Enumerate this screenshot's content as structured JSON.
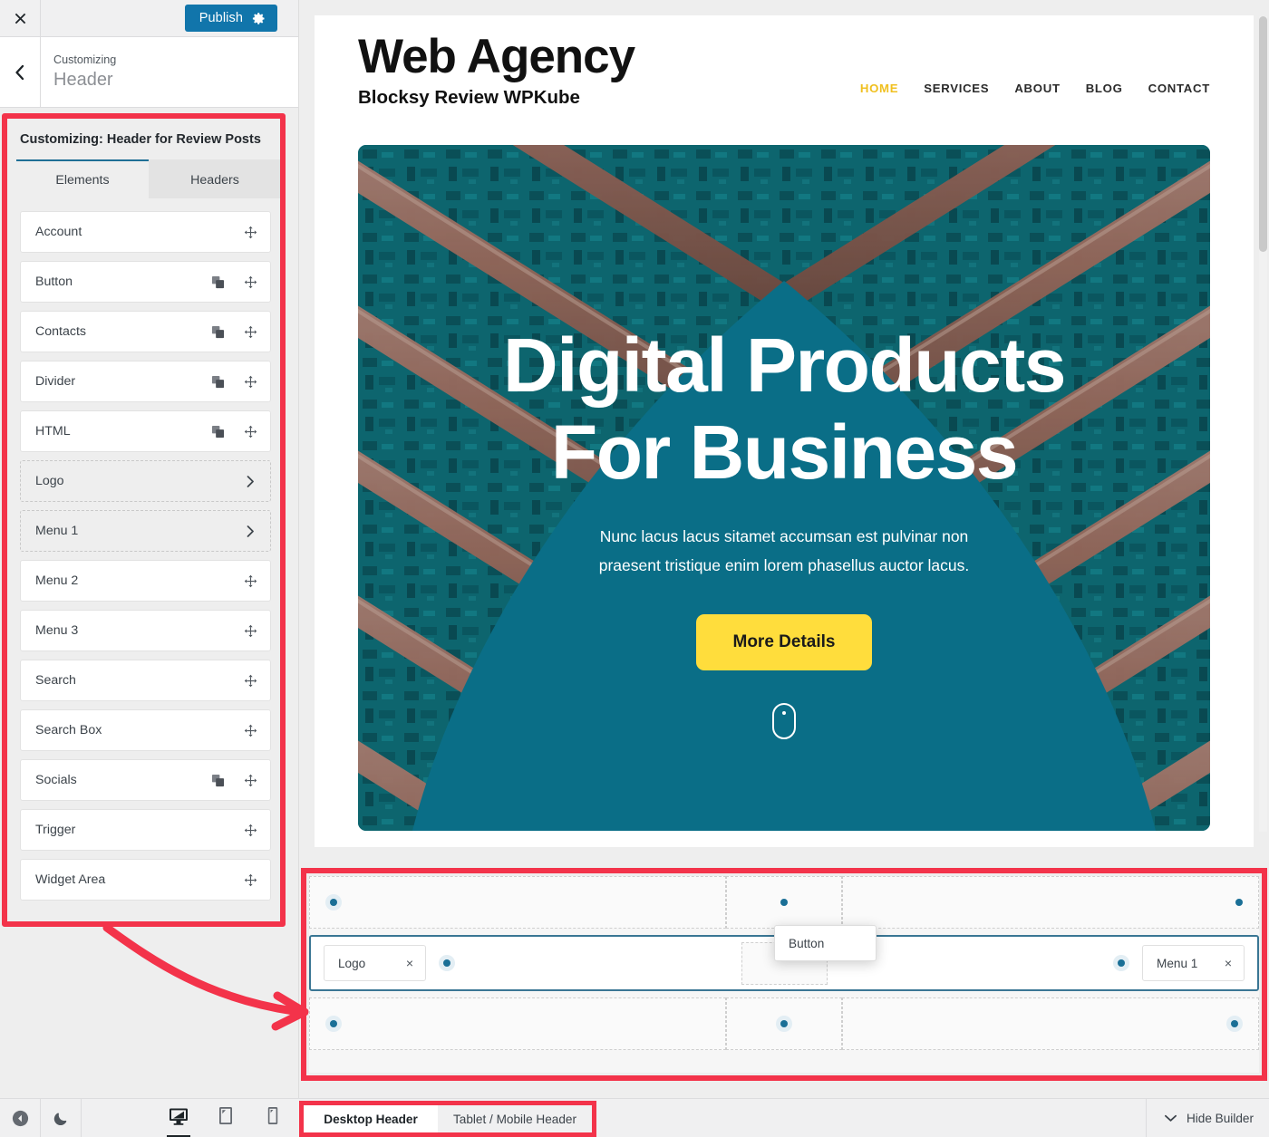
{
  "customizer": {
    "topbar": {
      "close_icon": "close-icon",
      "publish_label": "Publish",
      "gear_icon": "gear-icon"
    },
    "back_icon": "chevron-left-icon",
    "breadcrumb_label": "Customizing",
    "section_title": "Header",
    "panel_heading": "Customizing: Header for Review Posts",
    "tabs": [
      {
        "label": "Elements",
        "active": true
      },
      {
        "label": "Headers",
        "active": false
      }
    ],
    "elements": [
      {
        "label": "Account",
        "style": "solid",
        "has_copy": false,
        "has_move": true,
        "has_chevron": false
      },
      {
        "label": "Button",
        "style": "solid",
        "has_copy": true,
        "has_move": true,
        "has_chevron": false
      },
      {
        "label": "Contacts",
        "style": "solid",
        "has_copy": true,
        "has_move": true,
        "has_chevron": false
      },
      {
        "label": "Divider",
        "style": "solid",
        "has_copy": true,
        "has_move": true,
        "has_chevron": false
      },
      {
        "label": "HTML",
        "style": "solid",
        "has_copy": true,
        "has_move": true,
        "has_chevron": false
      },
      {
        "label": "Logo",
        "style": "dashed",
        "has_copy": false,
        "has_move": false,
        "has_chevron": true
      },
      {
        "label": "Menu 1",
        "style": "dashed",
        "has_copy": false,
        "has_move": false,
        "has_chevron": true
      },
      {
        "label": "Menu 2",
        "style": "solid",
        "has_copy": false,
        "has_move": true,
        "has_chevron": false
      },
      {
        "label": "Menu 3",
        "style": "solid",
        "has_copy": false,
        "has_move": true,
        "has_chevron": false
      },
      {
        "label": "Search",
        "style": "solid",
        "has_copy": false,
        "has_move": true,
        "has_chevron": false
      },
      {
        "label": "Search Box",
        "style": "solid",
        "has_copy": false,
        "has_move": true,
        "has_chevron": false
      },
      {
        "label": "Socials",
        "style": "solid",
        "has_copy": true,
        "has_move": true,
        "has_chevron": false
      },
      {
        "label": "Trigger",
        "style": "solid",
        "has_copy": false,
        "has_move": true,
        "has_chevron": false
      },
      {
        "label": "Widget Area",
        "style": "solid",
        "has_copy": false,
        "has_move": true,
        "has_chevron": false
      }
    ]
  },
  "preview": {
    "brand": {
      "title": "Web Agency",
      "subtitle": "Blocksy Review WPKube"
    },
    "nav": [
      {
        "label": "HOME",
        "active": true
      },
      {
        "label": "SERVICES",
        "active": false
      },
      {
        "label": "ABOUT",
        "active": false
      },
      {
        "label": "BLOG",
        "active": false
      },
      {
        "label": "CONTACT",
        "active": false
      }
    ],
    "hero": {
      "heading_line1": "Digital Products",
      "heading_line2": "For Business",
      "paragraph": "Nunc lacus lacus sitamet accumsan est pulvinar non praesent tristique enim lorem phasellus auctor lacus.",
      "button_label": "More Details",
      "scroll_icon": "scroll-mouse-icon"
    }
  },
  "builder": {
    "rows": [
      {
        "name": "top-row",
        "cells": [
          {
            "align": "left",
            "dot": "ring",
            "chips": []
          },
          {
            "align": "center",
            "dot": "plain",
            "chips": []
          },
          {
            "align": "right",
            "dot": "plain",
            "chips": []
          }
        ]
      },
      {
        "name": "middle-row",
        "selected": true,
        "cells": [
          {
            "align": "left",
            "dot": "ring",
            "chips": [
              {
                "label": "Logo",
                "close": "×"
              }
            ]
          },
          {
            "align": "center",
            "dot": "none",
            "chips": [
              {
                "label": "Button",
                "close": ""
              }
            ]
          },
          {
            "align": "right",
            "dot": "ring",
            "chips": [
              {
                "label": "Menu 1",
                "close": "×"
              }
            ]
          }
        ]
      },
      {
        "name": "bottom-row",
        "cells": [
          {
            "align": "left",
            "dot": "ring",
            "chips": []
          },
          {
            "align": "center",
            "dot": "ring",
            "chips": []
          },
          {
            "align": "right",
            "dot": "ring",
            "chips": []
          }
        ]
      }
    ]
  },
  "bottombar": {
    "collapse_icon": "collapse-sidebar-icon",
    "theme_icon": "moon-icon",
    "devices": [
      {
        "name": "desktop",
        "icon": "desktop-icon",
        "active": true
      },
      {
        "name": "tablet",
        "icon": "tablet-icon",
        "active": false
      },
      {
        "name": "mobile",
        "icon": "mobile-icon",
        "active": false
      }
    ],
    "header_tabs": [
      {
        "label": "Desktop Header",
        "active": true
      },
      {
        "label": "Tablet / Mobile Header",
        "active": false
      }
    ],
    "hide_builder_label": "Hide Builder",
    "hide_builder_icon": "chevron-down-icon"
  },
  "colors": {
    "publish_blue": "#1175ab",
    "annotation_red": "#f3334a",
    "accent_yellow": "#ffdd3c",
    "nav_active": "#f0c020",
    "hero_teal": "#0b7a94",
    "builder_selected_border": "#3a7694"
  }
}
